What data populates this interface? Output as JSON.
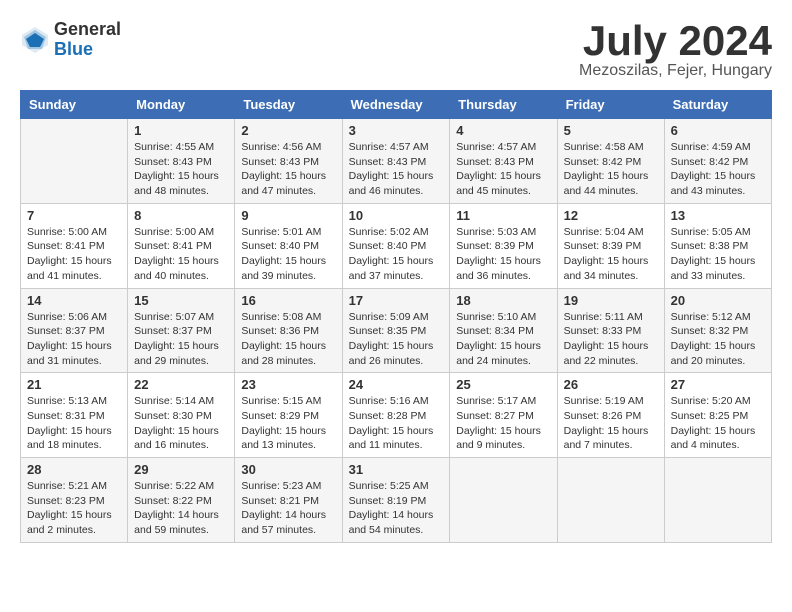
{
  "header": {
    "logo_general": "General",
    "logo_blue": "Blue",
    "month_title": "July 2024",
    "location": "Mezoszilas, Fejer, Hungary"
  },
  "weekdays": [
    "Sunday",
    "Monday",
    "Tuesday",
    "Wednesday",
    "Thursday",
    "Friday",
    "Saturday"
  ],
  "weeks": [
    [
      {
        "day": "",
        "info": ""
      },
      {
        "day": "1",
        "info": "Sunrise: 4:55 AM\nSunset: 8:43 PM\nDaylight: 15 hours\nand 48 minutes."
      },
      {
        "day": "2",
        "info": "Sunrise: 4:56 AM\nSunset: 8:43 PM\nDaylight: 15 hours\nand 47 minutes."
      },
      {
        "day": "3",
        "info": "Sunrise: 4:57 AM\nSunset: 8:43 PM\nDaylight: 15 hours\nand 46 minutes."
      },
      {
        "day": "4",
        "info": "Sunrise: 4:57 AM\nSunset: 8:43 PM\nDaylight: 15 hours\nand 45 minutes."
      },
      {
        "day": "5",
        "info": "Sunrise: 4:58 AM\nSunset: 8:42 PM\nDaylight: 15 hours\nand 44 minutes."
      },
      {
        "day": "6",
        "info": "Sunrise: 4:59 AM\nSunset: 8:42 PM\nDaylight: 15 hours\nand 43 minutes."
      }
    ],
    [
      {
        "day": "7",
        "info": "Sunrise: 5:00 AM\nSunset: 8:41 PM\nDaylight: 15 hours\nand 41 minutes."
      },
      {
        "day": "8",
        "info": "Sunrise: 5:00 AM\nSunset: 8:41 PM\nDaylight: 15 hours\nand 40 minutes."
      },
      {
        "day": "9",
        "info": "Sunrise: 5:01 AM\nSunset: 8:40 PM\nDaylight: 15 hours\nand 39 minutes."
      },
      {
        "day": "10",
        "info": "Sunrise: 5:02 AM\nSunset: 8:40 PM\nDaylight: 15 hours\nand 37 minutes."
      },
      {
        "day": "11",
        "info": "Sunrise: 5:03 AM\nSunset: 8:39 PM\nDaylight: 15 hours\nand 36 minutes."
      },
      {
        "day": "12",
        "info": "Sunrise: 5:04 AM\nSunset: 8:39 PM\nDaylight: 15 hours\nand 34 minutes."
      },
      {
        "day": "13",
        "info": "Sunrise: 5:05 AM\nSunset: 8:38 PM\nDaylight: 15 hours\nand 33 minutes."
      }
    ],
    [
      {
        "day": "14",
        "info": "Sunrise: 5:06 AM\nSunset: 8:37 PM\nDaylight: 15 hours\nand 31 minutes."
      },
      {
        "day": "15",
        "info": "Sunrise: 5:07 AM\nSunset: 8:37 PM\nDaylight: 15 hours\nand 29 minutes."
      },
      {
        "day": "16",
        "info": "Sunrise: 5:08 AM\nSunset: 8:36 PM\nDaylight: 15 hours\nand 28 minutes."
      },
      {
        "day": "17",
        "info": "Sunrise: 5:09 AM\nSunset: 8:35 PM\nDaylight: 15 hours\nand 26 minutes."
      },
      {
        "day": "18",
        "info": "Sunrise: 5:10 AM\nSunset: 8:34 PM\nDaylight: 15 hours\nand 24 minutes."
      },
      {
        "day": "19",
        "info": "Sunrise: 5:11 AM\nSunset: 8:33 PM\nDaylight: 15 hours\nand 22 minutes."
      },
      {
        "day": "20",
        "info": "Sunrise: 5:12 AM\nSunset: 8:32 PM\nDaylight: 15 hours\nand 20 minutes."
      }
    ],
    [
      {
        "day": "21",
        "info": "Sunrise: 5:13 AM\nSunset: 8:31 PM\nDaylight: 15 hours\nand 18 minutes."
      },
      {
        "day": "22",
        "info": "Sunrise: 5:14 AM\nSunset: 8:30 PM\nDaylight: 15 hours\nand 16 minutes."
      },
      {
        "day": "23",
        "info": "Sunrise: 5:15 AM\nSunset: 8:29 PM\nDaylight: 15 hours\nand 13 minutes."
      },
      {
        "day": "24",
        "info": "Sunrise: 5:16 AM\nSunset: 8:28 PM\nDaylight: 15 hours\nand 11 minutes."
      },
      {
        "day": "25",
        "info": "Sunrise: 5:17 AM\nSunset: 8:27 PM\nDaylight: 15 hours\nand 9 minutes."
      },
      {
        "day": "26",
        "info": "Sunrise: 5:19 AM\nSunset: 8:26 PM\nDaylight: 15 hours\nand 7 minutes."
      },
      {
        "day": "27",
        "info": "Sunrise: 5:20 AM\nSunset: 8:25 PM\nDaylight: 15 hours\nand 4 minutes."
      }
    ],
    [
      {
        "day": "28",
        "info": "Sunrise: 5:21 AM\nSunset: 8:23 PM\nDaylight: 15 hours\nand 2 minutes."
      },
      {
        "day": "29",
        "info": "Sunrise: 5:22 AM\nSunset: 8:22 PM\nDaylight: 14 hours\nand 59 minutes."
      },
      {
        "day": "30",
        "info": "Sunrise: 5:23 AM\nSunset: 8:21 PM\nDaylight: 14 hours\nand 57 minutes."
      },
      {
        "day": "31",
        "info": "Sunrise: 5:25 AM\nSunset: 8:19 PM\nDaylight: 14 hours\nand 54 minutes."
      },
      {
        "day": "",
        "info": ""
      },
      {
        "day": "",
        "info": ""
      },
      {
        "day": "",
        "info": ""
      }
    ]
  ]
}
